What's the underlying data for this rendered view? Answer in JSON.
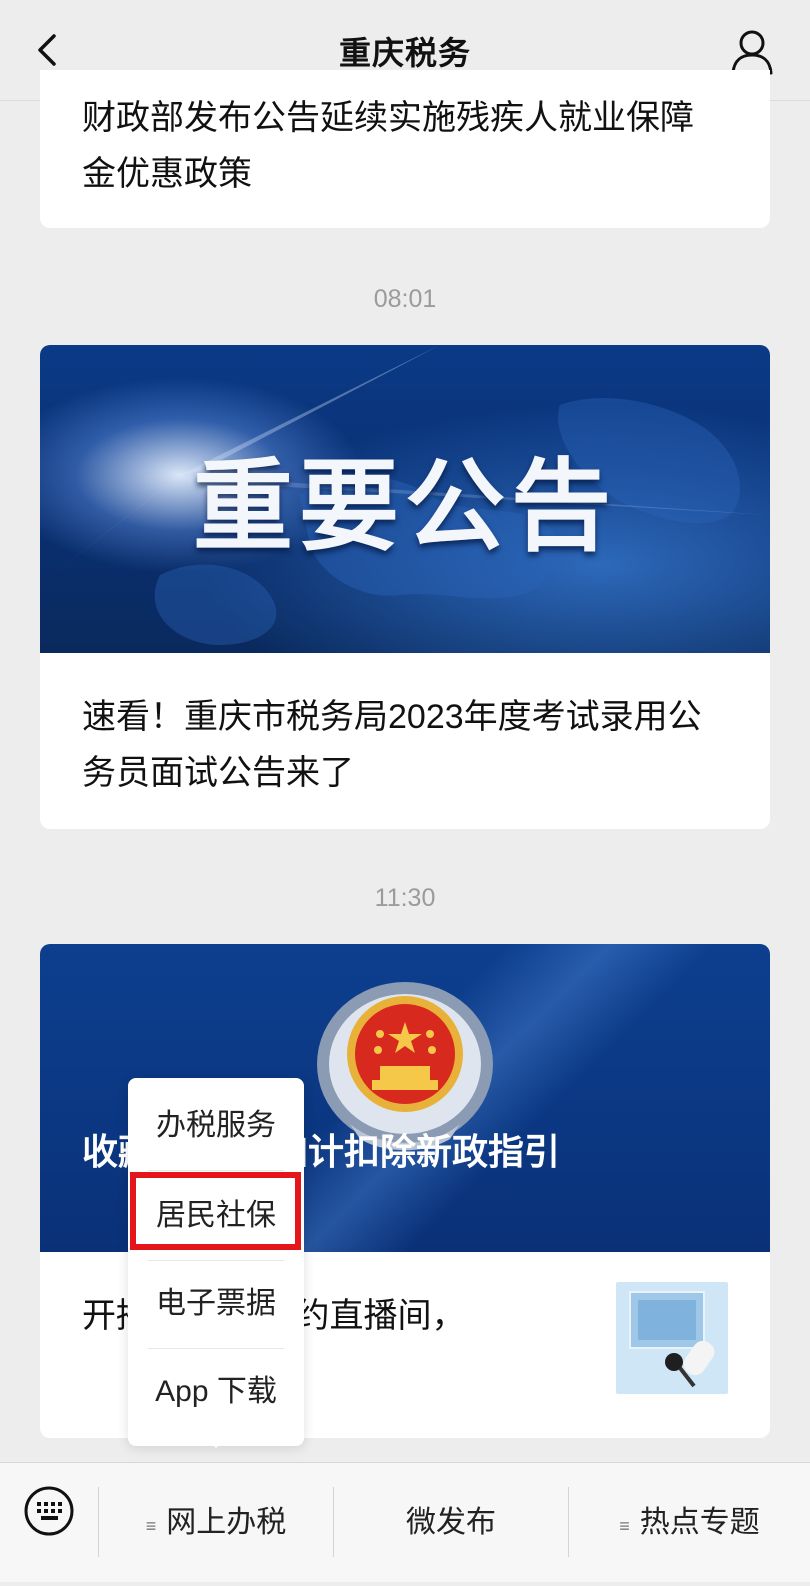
{
  "header": {
    "title": "重庆税务"
  },
  "feed": {
    "card1_text": "财政部发布公告延续实施残疾人就业保障金优惠政策",
    "time1": "08:01",
    "card2_banner": "重要公告",
    "card2_text": "速看！重庆市税务局2023年度考试录用公务员面试公告来了",
    "time2": "11:30",
    "card3_headline": "收藏 用税前加计扣除新政指引",
    "card3_sub": "开播 下午，相约直播间，"
  },
  "popup_menu": {
    "items": [
      "办税服务",
      "居民社保",
      "电子票据",
      "App 下载"
    ],
    "highlighted": "居民社保"
  },
  "bottom_menu": {
    "tabs": [
      {
        "label": "网上办税",
        "has_submenu": true,
        "highlighted": true
      },
      {
        "label": "微发布",
        "has_submenu": false
      },
      {
        "label": "热点专题",
        "has_submenu": true
      }
    ],
    "submenu_marker": "≡"
  },
  "colors": {
    "highlight": "#e5161b",
    "background": "#ededed"
  }
}
